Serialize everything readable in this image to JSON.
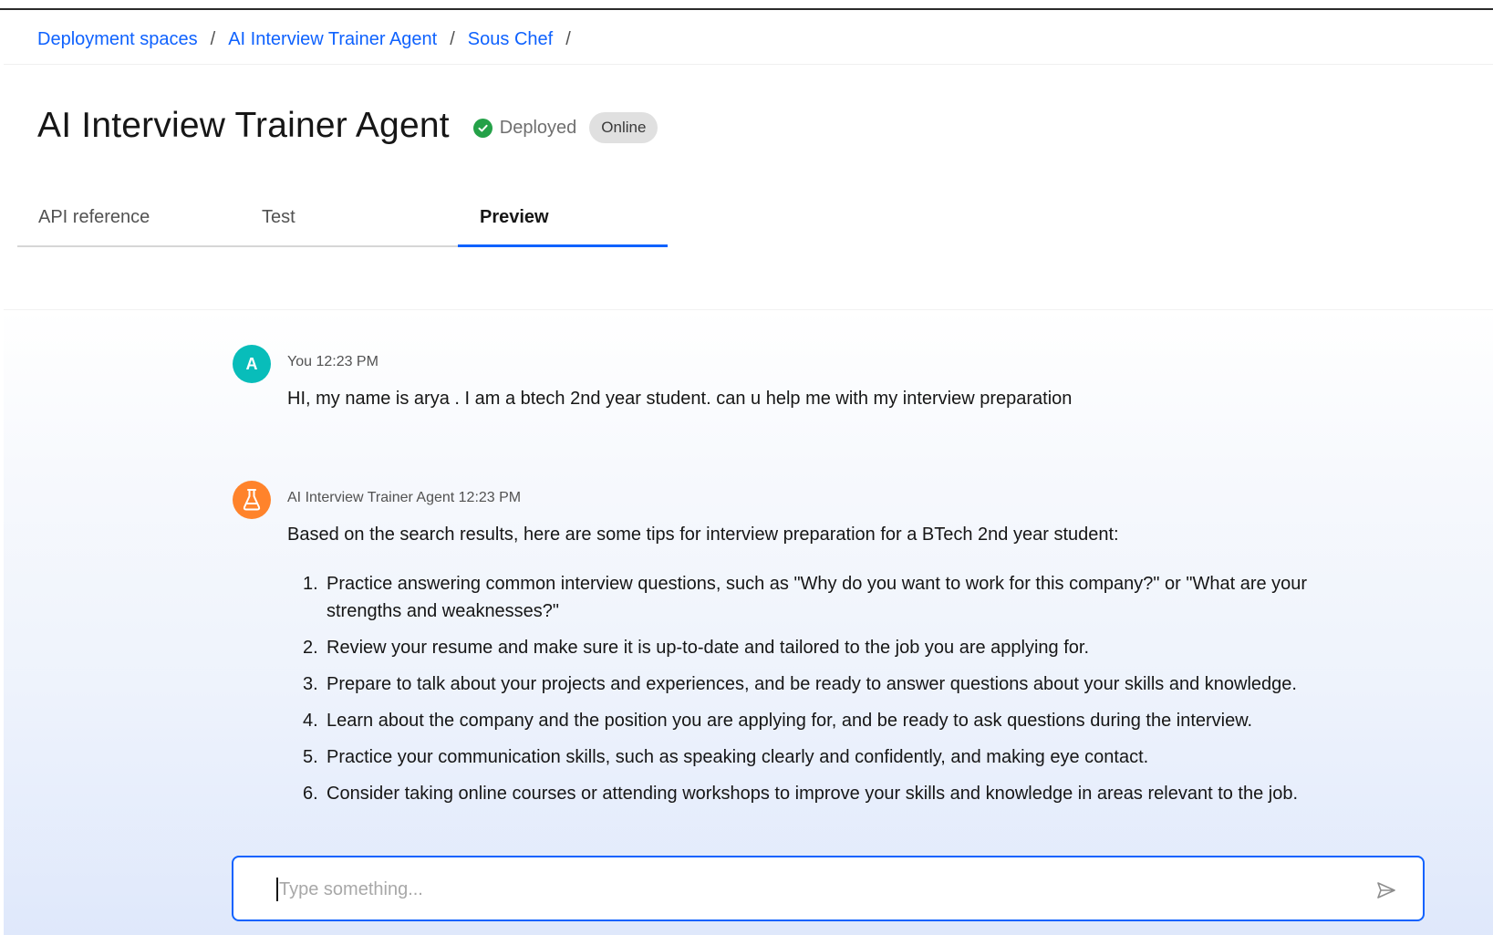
{
  "breadcrumb": {
    "items": [
      "Deployment spaces",
      "AI Interview Trainer Agent",
      "Sous Chef"
    ],
    "separator": "/"
  },
  "header": {
    "title": "AI Interview Trainer Agent",
    "status": "Deployed",
    "tag": "Online"
  },
  "tabs": [
    {
      "label": "API reference",
      "active": false
    },
    {
      "label": "Test",
      "active": false
    },
    {
      "label": "Preview",
      "active": true
    }
  ],
  "chat": {
    "messages": [
      {
        "avatar": "A",
        "meta": "You 12:23 PM",
        "text": "HI, my name is arya . I am a btech 2nd year student. can u help me with my interview preparation"
      },
      {
        "avatar_icon": "flask-icon",
        "meta": "AI Interview Trainer Agent 12:23 PM",
        "text": "Based on the search results, here are some tips for interview preparation for a BTech 2nd year student:",
        "list": [
          {
            "num": "1.",
            "text": "Practice answering common interview questions, such as \"Why do you want to work for this company?\" or \"What are your strengths and weaknesses?\""
          },
          {
            "num": "2.",
            "text": "Review your resume and make sure it is up-to-date and tailored to the job you are applying for."
          },
          {
            "num": "3.",
            "text": "Prepare to talk about your projects and experiences, and be ready to answer questions about your skills and knowledge."
          },
          {
            "num": "4.",
            "text": "Learn about the company and the position you are applying for, and be ready to ask questions during the interview."
          },
          {
            "num": "5.",
            "text": "Practice your communication skills, such as speaking clearly and confidently, and making eye contact."
          },
          {
            "num": "6.",
            "text": "Consider taking online courses or attending workshops to improve your skills and knowledge in areas relevant to the job."
          }
        ]
      }
    ]
  },
  "input": {
    "placeholder": "Type something...",
    "value": ""
  },
  "colors": {
    "link": "#0f62fe",
    "deployed": "#24a148",
    "user_avatar": "#08bdba",
    "agent_avatar": "#ff832b"
  }
}
